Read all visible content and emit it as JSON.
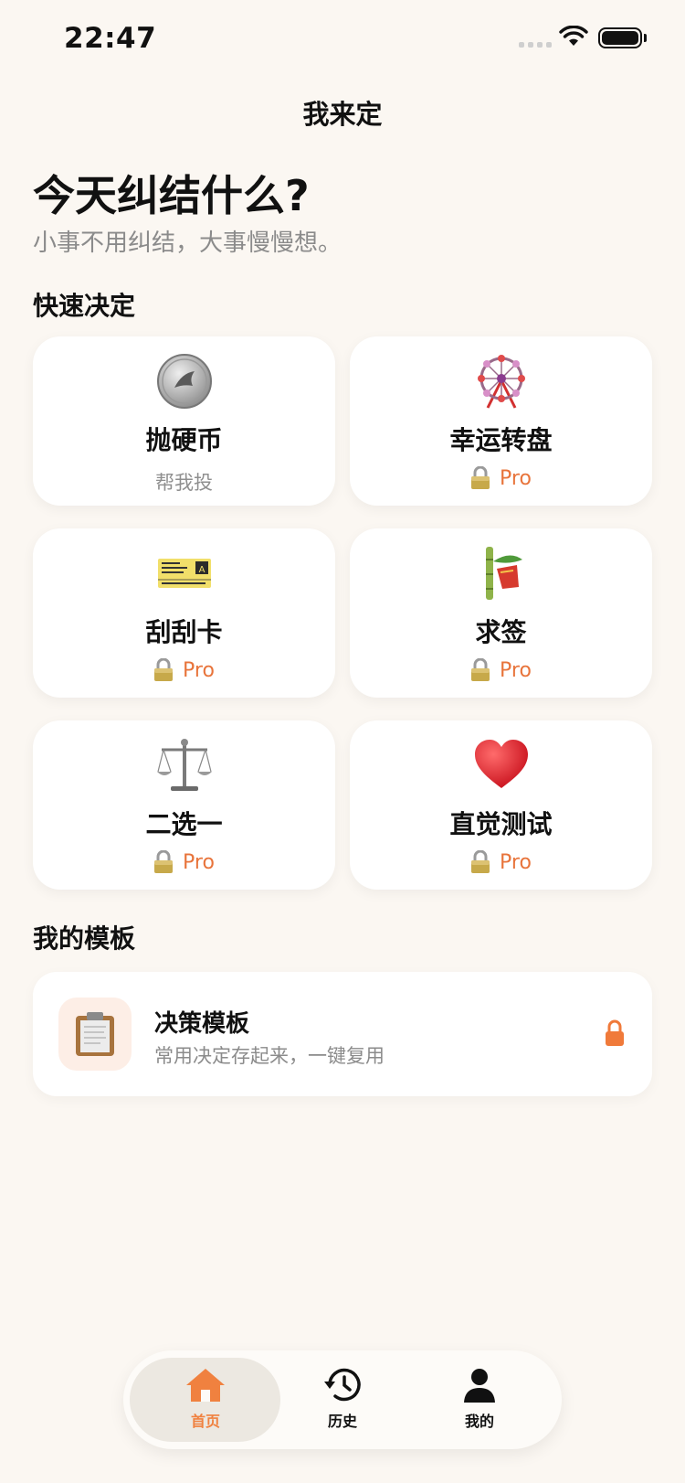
{
  "status_bar": {
    "time": "22:47"
  },
  "nav": {
    "title": "我来定"
  },
  "hero": {
    "headline": "今天纠结什么?",
    "subline": "小事不用纠结，大事慢慢想。"
  },
  "quick": {
    "section_title": "快速决定",
    "cards": [
      {
        "title": "抛硬币",
        "subtitle": "帮我投",
        "icon": "coin-icon",
        "locked": false
      },
      {
        "title": "幸运转盘",
        "badge": "Pro",
        "icon": "ferris-wheel-icon",
        "locked": true
      },
      {
        "title": "刮刮卡",
        "badge": "Pro",
        "icon": "ticket-icon",
        "locked": true
      },
      {
        "title": "求签",
        "badge": "Pro",
        "icon": "tanabata-tree-icon",
        "locked": true
      },
      {
        "title": "二选一",
        "badge": "Pro",
        "icon": "scales-icon",
        "locked": true
      },
      {
        "title": "直觉测试",
        "badge": "Pro",
        "icon": "heart-icon",
        "locked": true
      }
    ]
  },
  "templates": {
    "section_title": "我的模板",
    "item": {
      "title": "决策模板",
      "subtitle": "常用决定存起来，一键复用",
      "icon": "clipboard-icon",
      "locked": true
    }
  },
  "tabbar": {
    "active": "home",
    "items": [
      {
        "label": "首页",
        "icon": "home-icon"
      },
      {
        "label": "历史",
        "icon": "history-icon"
      },
      {
        "label": "我的",
        "icon": "person-icon"
      }
    ]
  },
  "colors": {
    "background": "#fbf7f2",
    "accent": "#f0813f",
    "pro_text": "#e8743b"
  }
}
